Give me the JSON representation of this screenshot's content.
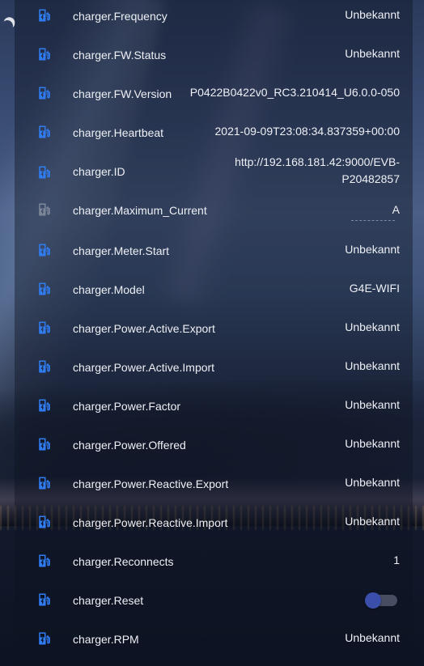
{
  "colors": {
    "icon_active": "#2f7cf3",
    "icon_disabled": "#7d8799",
    "toggle_knob": "#3b4eaa"
  },
  "entities": [
    {
      "label": "charger.Frequency",
      "value": "Unbekannt",
      "icon": "ev-station-icon"
    },
    {
      "label": "charger.FW.Status",
      "value": "Unbekannt",
      "icon": "ev-station-icon"
    },
    {
      "label": "charger.FW.Version",
      "value": "P0422B0422v0_RC3.210414_U6.0.0-050",
      "icon": "ev-station-icon"
    },
    {
      "label": "charger.Heartbeat",
      "value": "2021-09-09T23:08:34.837359+00:00",
      "icon": "ev-station-icon"
    },
    {
      "label": "charger.ID",
      "value": "http://192.168.181.42:9000/EVB-P20482857",
      "icon": "ev-station-icon"
    },
    {
      "label": "charger.Maximum_Current",
      "value": "A",
      "icon": "ev-station-icon",
      "disabled": true
    },
    {
      "label": "charger.Meter.Start",
      "value": "Unbekannt",
      "icon": "ev-station-icon"
    },
    {
      "label": "charger.Model",
      "value": "G4E-WIFI",
      "icon": "ev-station-icon"
    },
    {
      "label": "charger.Power.Active.Export",
      "value": "Unbekannt",
      "icon": "ev-station-icon"
    },
    {
      "label": "charger.Power.Active.Import",
      "value": "Unbekannt",
      "icon": "ev-station-icon"
    },
    {
      "label": "charger.Power.Factor",
      "value": "Unbekannt",
      "icon": "ev-station-icon"
    },
    {
      "label": "charger.Power.Offered",
      "value": "Unbekannt",
      "icon": "ev-station-icon"
    },
    {
      "label": "charger.Power.Reactive.Export",
      "value": "Unbekannt",
      "icon": "ev-station-icon"
    },
    {
      "label": "charger.Power.Reactive.Import",
      "value": "Unbekannt",
      "icon": "ev-station-icon"
    },
    {
      "label": "charger.Reconnects",
      "value": "1",
      "icon": "ev-station-icon"
    },
    {
      "label": "charger.Reset",
      "value": "",
      "icon": "ev-station-icon",
      "toggle": "off"
    },
    {
      "label": "charger.RPM",
      "value": "Unbekannt",
      "icon": "ev-station-icon"
    }
  ]
}
